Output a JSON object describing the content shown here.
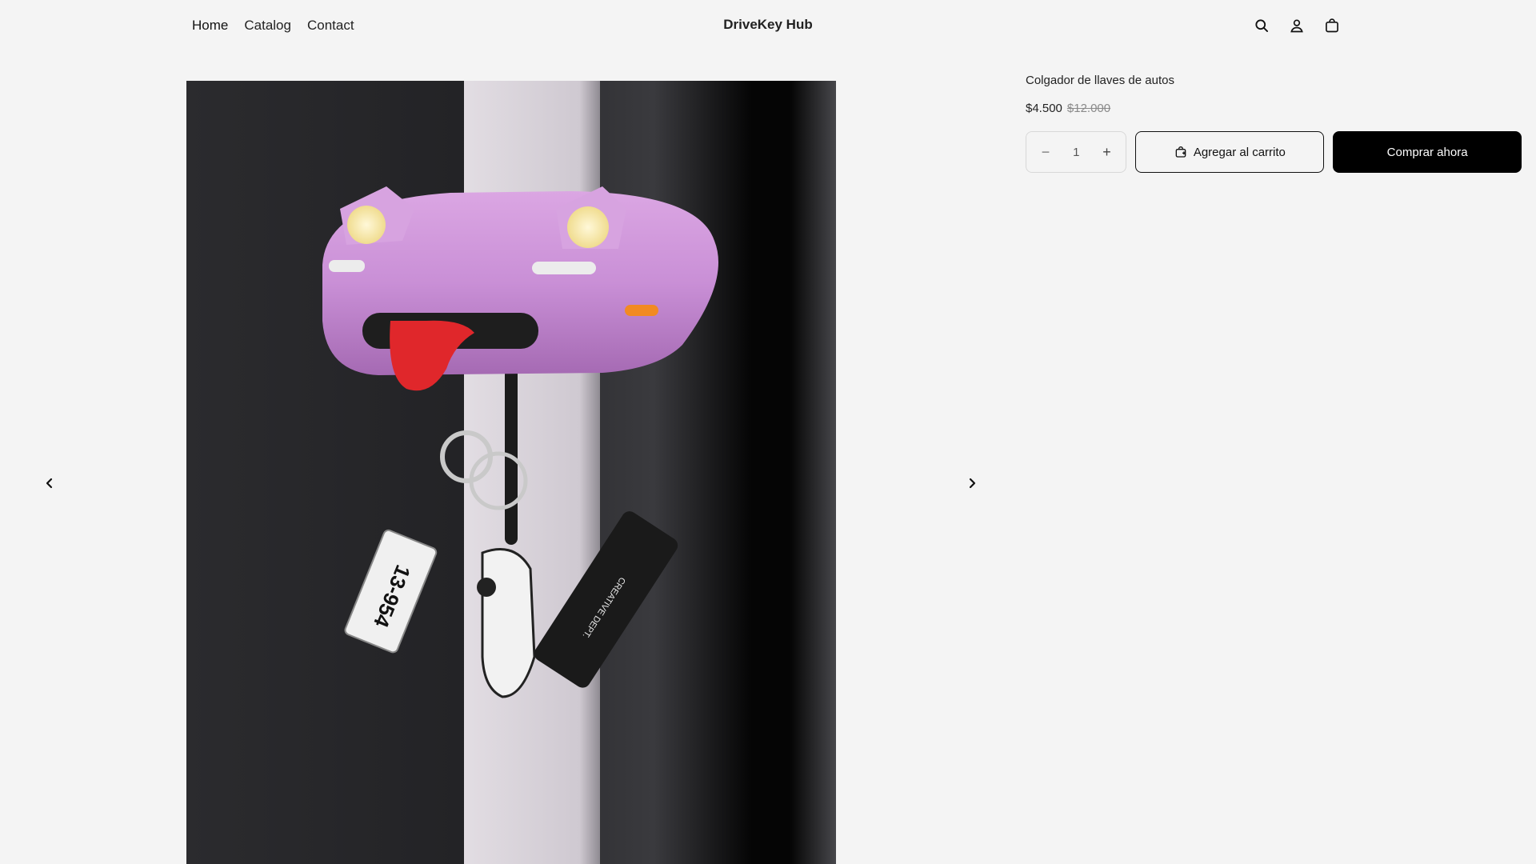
{
  "header": {
    "nav": [
      {
        "label": "Home"
      },
      {
        "label": "Catalog"
      },
      {
        "label": "Contact"
      }
    ],
    "brand": "DriveKey Hub",
    "icons": [
      "search-icon",
      "account-icon",
      "cart-icon"
    ]
  },
  "gallery": {
    "prev_icon": "chevron-left-icon",
    "next_icon": "chevron-right-icon",
    "image_alt": "Colgador de llaves de autos"
  },
  "product": {
    "title": "Colgador de llaves de autos",
    "price": "$4.500",
    "old_price": "$12.000",
    "quantity": "1",
    "add_to_cart": "Agregar al carrito",
    "buy_now": "Comprar ahora"
  },
  "colors": {
    "background": "#f4f4f4",
    "primary_button": "#000000",
    "accent_pink": "#c98fd6"
  }
}
